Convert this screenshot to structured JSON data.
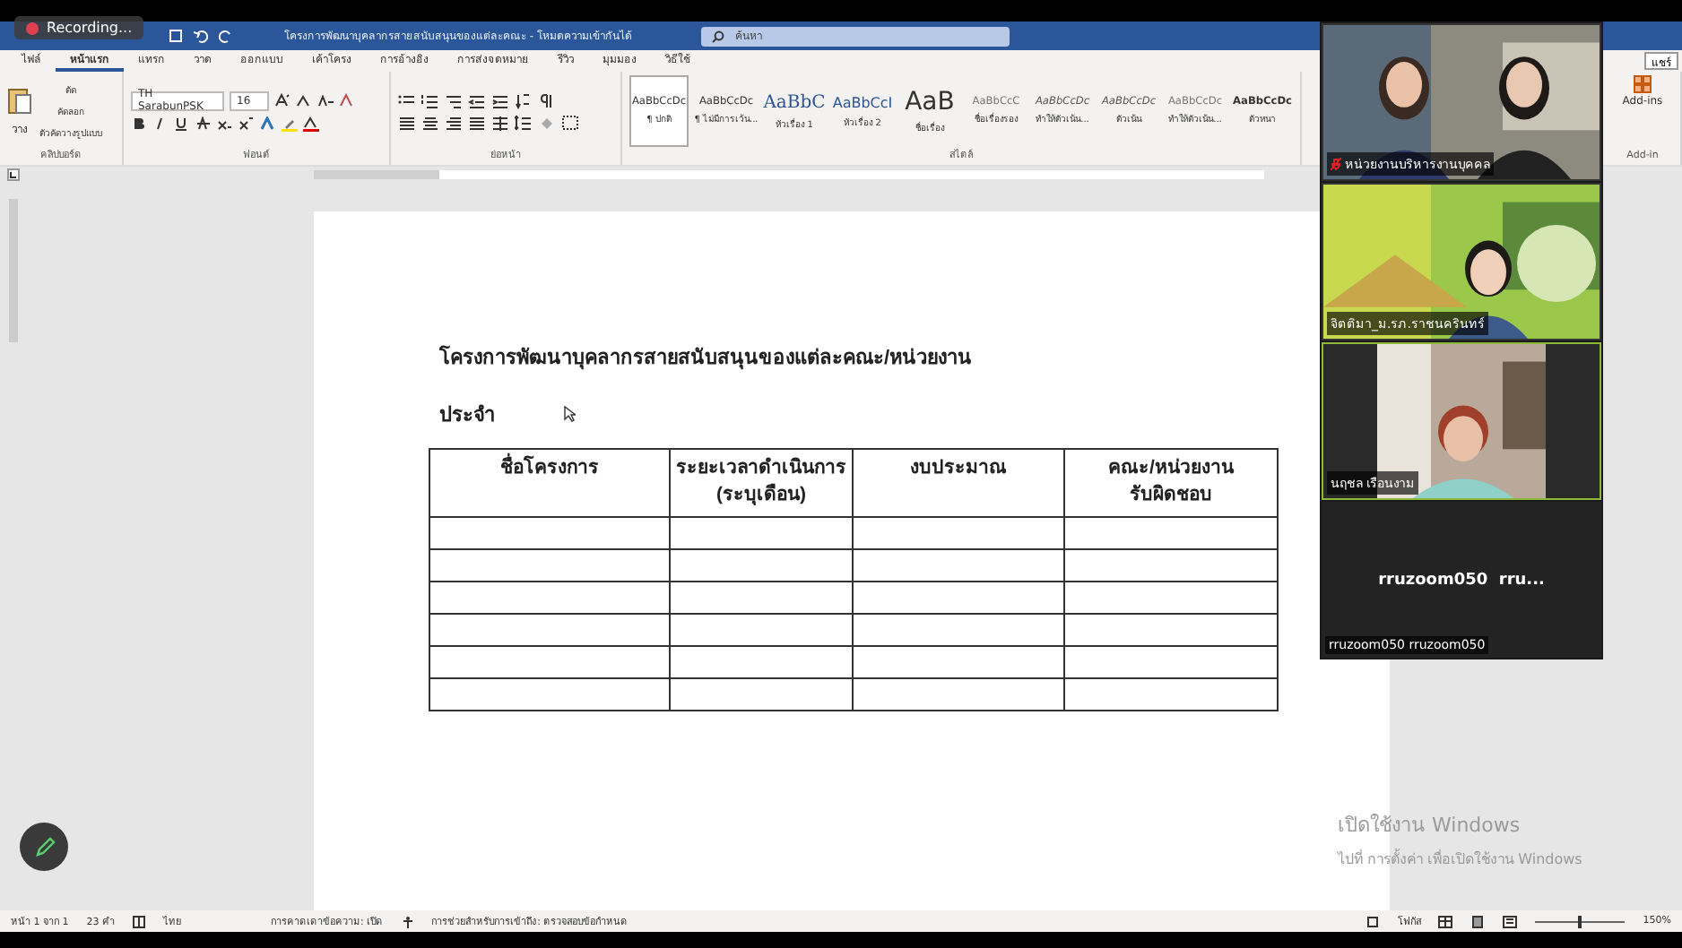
{
  "window": {
    "title": "โครงการพัฒนาบุคลากรสายสนับสนุนของแต่ละคณะ - โหมดความเข้ากันได้",
    "search": {
      "placeholder": "ค้นหา"
    },
    "share": "แชร์"
  },
  "recording": {
    "label": "Recording..."
  },
  "tabs": [
    {
      "label": "ไฟล์",
      "selected": false
    },
    {
      "label": "หน้าแรก",
      "selected": true
    },
    {
      "label": "แทรก",
      "selected": false
    },
    {
      "label": "วาด",
      "selected": false
    },
    {
      "label": "ออกแบบ",
      "selected": false
    },
    {
      "label": "เค้าโครง",
      "selected": false
    },
    {
      "label": "การอ้างอิง",
      "selected": false
    },
    {
      "label": "การส่งจดหมาย",
      "selected": false
    },
    {
      "label": "รีวิว",
      "selected": false
    },
    {
      "label": "มุมมอง",
      "selected": false
    },
    {
      "label": "วิธีใช้",
      "selected": false
    }
  ],
  "ribbon": {
    "paste": "วาง",
    "cut": "ตัด",
    "copy": "คัดลอก",
    "format_painter": "ตัวคัดวางรูปแบบ",
    "font": "TH SarabunPSK",
    "size": "16",
    "groups": [
      "คลิปบอร์ด",
      "ฟอนต์",
      "ย่อหน้า",
      "สไตล์"
    ],
    "styles": [
      {
        "sample": "AaBbCcDc",
        "label": "¶ ปกติ",
        "kind": "small",
        "selected": true
      },
      {
        "sample": "AaBbCcDc",
        "label": "¶ ไม่มีการเว้น...",
        "kind": "small",
        "selected": false
      },
      {
        "sample": "AaBbC",
        "label": "หัวเรื่อง 1",
        "kind": "heading",
        "selected": false
      },
      {
        "sample": "AaBbCcI",
        "label": "หัวเรื่อง 2",
        "kind": "heading2",
        "selected": false
      },
      {
        "sample": "AaB",
        "label": "ชื่อเรื่อง",
        "kind": "title",
        "selected": false
      },
      {
        "sample": "AaBbCcC",
        "label": "ชื่อเรื่องรอง",
        "kind": "subtle",
        "selected": false
      },
      {
        "sample": "AaBbCcDc",
        "label": "ทำให้ตัวเน้น...",
        "kind": "italic",
        "selected": false
      },
      {
        "sample": "AaBbCcDc",
        "label": "ตัวเน้น",
        "kind": "italic",
        "selected": false
      },
      {
        "sample": "AaBbCcDc",
        "label": "ทำให้ตัวเน้น...",
        "kind": "subtle",
        "selected": false
      },
      {
        "sample": "AaBbCcDc",
        "label": "ตัวหนา",
        "kind": "bold",
        "selected": false
      }
    ],
    "addins": "Add-ins",
    "addin_group": "Add-in"
  },
  "document": {
    "heading": "โครงการพัฒนาบุคลากรสายสนับสนุนของแต่ละคณะ/หน่วยงาน",
    "subheading": "ประจำ",
    "table": {
      "columns": [
        "ชื่อโครงการ",
        "ระยะเวลาดำเนินการ\n(ระบุเดือน)",
        "งบประมาณ",
        "คณะ/หน่วยงาน\nรับผิดชอบ"
      ]
    }
  },
  "status_bar": {
    "page": "หน้า 1 จาก 1",
    "words": "23 คำ",
    "language": "ไทย",
    "prediction": "การคาดเดาข้อความ: เปิด",
    "accessibility": "การช่วยสำหรับการเข้าถึง: ตรวจสอบข้อกำหนด",
    "focus": "โฟกัส",
    "zoom_slider": {
      "level": 0.5
    },
    "zoom": "150%"
  },
  "meeting": {
    "tiles": [
      {
        "kind": "video",
        "name": "หน่วยงานบริหารงานบุคคล",
        "muted": true,
        "speaking": false
      },
      {
        "kind": "video",
        "name": "จิตติมา_ม.รภ.ราชนครินทร์",
        "muted": false,
        "speaking": false
      },
      {
        "kind": "video",
        "name": "นฤชล เรือนงาม",
        "muted": false,
        "speaking": true
      },
      {
        "kind": "name",
        "center": "rruzoom050  rru...",
        "name": "rruzoom050 rruzoom050",
        "muted": false,
        "speaking": false
      }
    ]
  },
  "activation": {
    "title": "เปิดใช้งาน Windows",
    "hint": "ไปที่ การตั้งค่า เพื่อเปิดใช้งาน Windows"
  }
}
